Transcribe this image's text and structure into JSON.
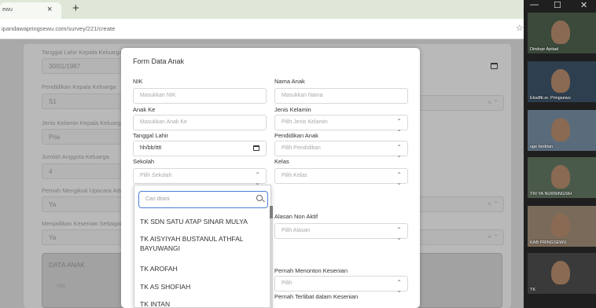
{
  "browser": {
    "tab_title": "ewu",
    "tab_close": "×",
    "new_tab": "+",
    "url": "ipandawapringsewu.com/survey/221/create",
    "bookmark_star": "☆"
  },
  "background_form": {
    "fields": [
      {
        "label": "Tanggal Lahir Kepala Keluarga",
        "value": "30/01/1987"
      },
      {
        "label": "Pendidikan Kepala Keluarga",
        "value": "S1"
      },
      {
        "label": "Jenis Kelamin Kepala Keluarga",
        "value": "Pria"
      },
      {
        "label": "Jumlah Anggota Keluarga",
        "value": "4"
      },
      {
        "label": "Pernah Mengikuti Upacara Adat",
        "value": "Ya"
      },
      {
        "label": "Menjadikan Kesenian Sebagai",
        "value": "Ya"
      }
    ],
    "data_anak_title": "DATA ANAK",
    "data_anak_nik": "NIK"
  },
  "modal": {
    "title": "Form Data Anak",
    "nik": {
      "label": "NIK",
      "placeholder": "Masukkan NIK"
    },
    "nama_anak": {
      "label": "Nama Anak",
      "placeholder": "Masukkan Nama"
    },
    "anak_ke": {
      "label": "Anak Ke",
      "placeholder": "Masukkan Anak Ke"
    },
    "jenis_kelamin": {
      "label": "Jenis Kelamin",
      "placeholder": "Pilih Jenis Kelamin"
    },
    "tanggal_lahir": {
      "label": "Tanggal Lahir",
      "value": "hh/bb/tttt"
    },
    "pendidikan_anak": {
      "label": "Pendidikan Anak",
      "placeholder": "Pilih Pendidikan"
    },
    "sekolah": {
      "label": "Sekolah",
      "placeholder": "Pilih Sekolah"
    },
    "kelas": {
      "label": "Kelas",
      "placeholder": "Pilih Kelas"
    },
    "alasan_non_aktif": {
      "label": "Alasan Non Aktif",
      "placeholder": "Pilih Alasan"
    },
    "pernah_menonton": {
      "label": "Pernah Menonton Kesenian",
      "placeholder": "Pilih"
    },
    "pernah_terlibat": {
      "label": "Pernah Terlibat dalam Kesenian"
    }
  },
  "dropdown": {
    "search_placeholder": "Cari disini",
    "items": [
      "TK SDN SATU ATAP SINAR MULYA",
      "TK AISYIYAH BUSTANUL ATHFAL BAYUWANGI",
      "TK AROFAH",
      "TK AS SHOFIAH",
      "TK INTAN"
    ]
  },
  "video_call": {
    "participants": [
      {
        "name": "Dindopr Aptiad",
        "bg": "#3b4a3a"
      },
      {
        "name": "Eksdftr.er. Pringsewu",
        "bg": "#2e3f4f"
      },
      {
        "name": "uge bedrian",
        "bg": "#5a6b7c"
      },
      {
        "name": "TRI YA NURNINGSIH",
        "bg": "#4a5a4a"
      },
      {
        "name": "KAB PRINGSEWU",
        "bg": "#7a6a5a"
      },
      {
        "name": "TK",
        "bg": "#3a3a3a"
      }
    ]
  }
}
